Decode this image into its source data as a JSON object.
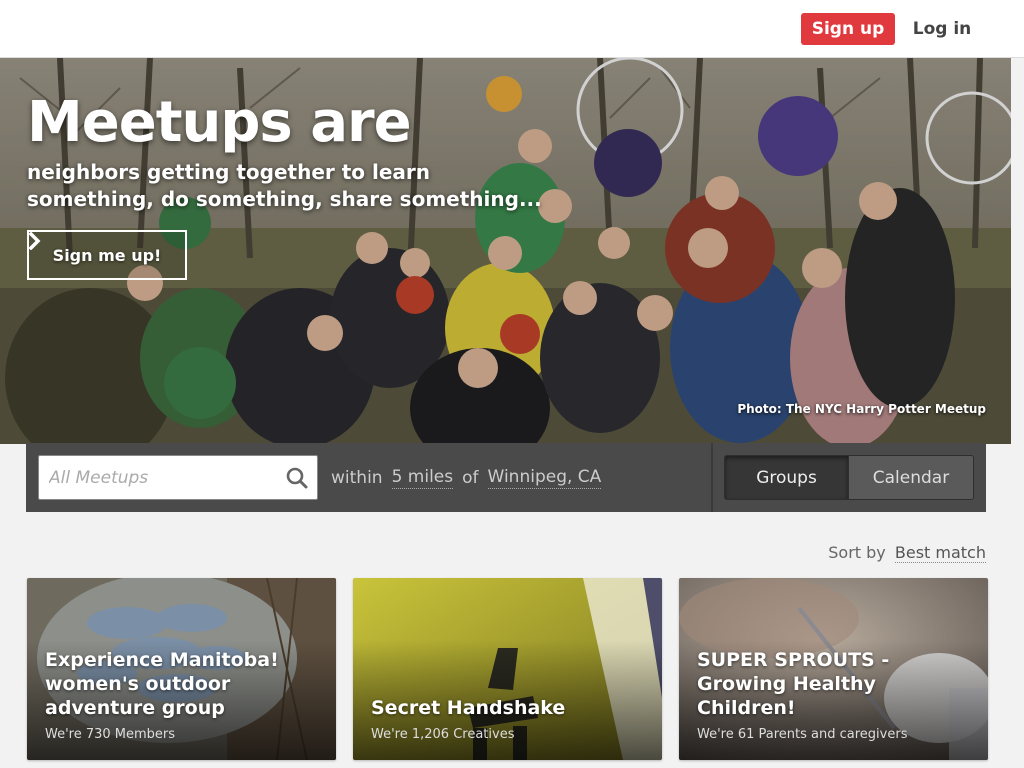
{
  "header": {
    "signup_label": "Sign up",
    "login_label": "Log in"
  },
  "hero": {
    "title": "Meetups are",
    "subtitle": "neighbors getting together to learn something, do something, share something...",
    "cta_label": "Sign me up!",
    "cta_icon": "chevron-right-icon",
    "photo_credit": "Photo: The NYC Harry Potter Meetup"
  },
  "search": {
    "placeholder": "All Meetups",
    "value": "",
    "icon": "search-icon",
    "within_label": "within",
    "radius": "5 miles",
    "of_label": "of",
    "location": "Winnipeg, CA"
  },
  "view_toggle": {
    "groups_label": "Groups",
    "calendar_label": "Calendar",
    "selected": "Groups"
  },
  "sort": {
    "label": "Sort by",
    "value": "Best match"
  },
  "cards": [
    {
      "title": "Experience Manitoba! women's outdoor adventure group",
      "meta": "We're 730 Members"
    },
    {
      "title": "Secret Handshake",
      "meta": "We're 1,206 Creatives"
    },
    {
      "title": "SUPER SPROUTS - Growing Healthy Children!",
      "meta": "We're 61 Parents and caregivers"
    }
  ],
  "colors": {
    "brand_red": "#e0393e",
    "search_bar_bg": "#4a4a4a",
    "page_bg": "#f2f2f2"
  }
}
